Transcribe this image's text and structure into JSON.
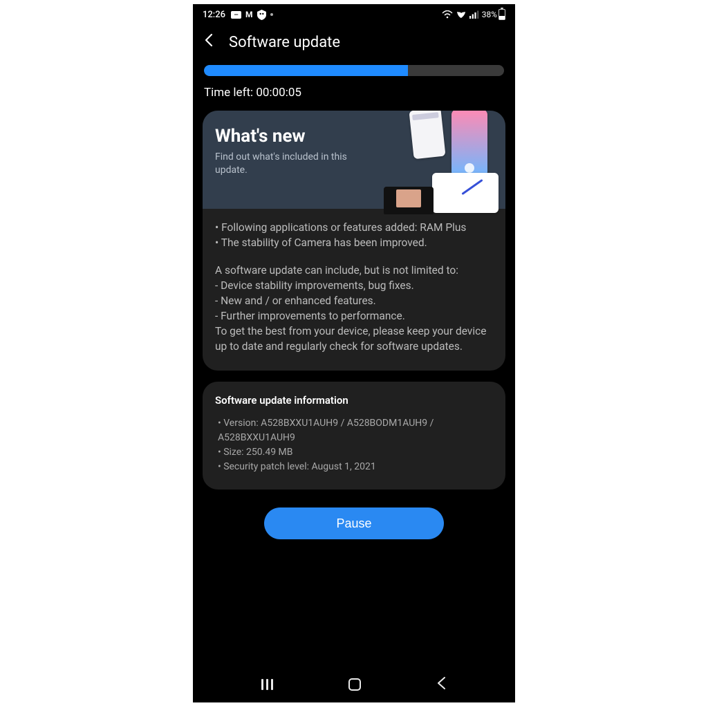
{
  "status_bar": {
    "time": "12:26",
    "battery_pct": "38%",
    "icons_left": [
      "card-icon",
      "gmail-icon",
      "privacy-icon",
      "dot-icon"
    ],
    "icons_right": [
      "wifi-calling-icon",
      "vowifi-icon",
      "signal-icon",
      "battery-icon"
    ]
  },
  "header": {
    "title": "Software update"
  },
  "progress": {
    "percent": 68,
    "time_left_label": "Time left: 00:00:05"
  },
  "whatsnew": {
    "title": "What's new",
    "subtitle": "Find out what's included in this update."
  },
  "notes": {
    "bullets": [
      "• Following applications or features added: RAM Plus",
      "• The stability of Camera has been improved."
    ],
    "intro": "A software update can include, but is not limited to:",
    "items": [
      " - Device stability improvements, bug fixes.",
      " - New and / or enhanced features.",
      " - Further improvements to performance."
    ],
    "outro": "To get the best from your device, please keep your device up to date and regularly check for software updates."
  },
  "info": {
    "heading": "Software update information",
    "rows": [
      "• Version: A528BXXU1AUH9 / A528BODM1AUH9 / A528BXXU1AUH9",
      "• Size: 250.49 MB",
      "• Security patch level: August 1, 2021"
    ]
  },
  "action": {
    "pause_label": "Pause"
  }
}
